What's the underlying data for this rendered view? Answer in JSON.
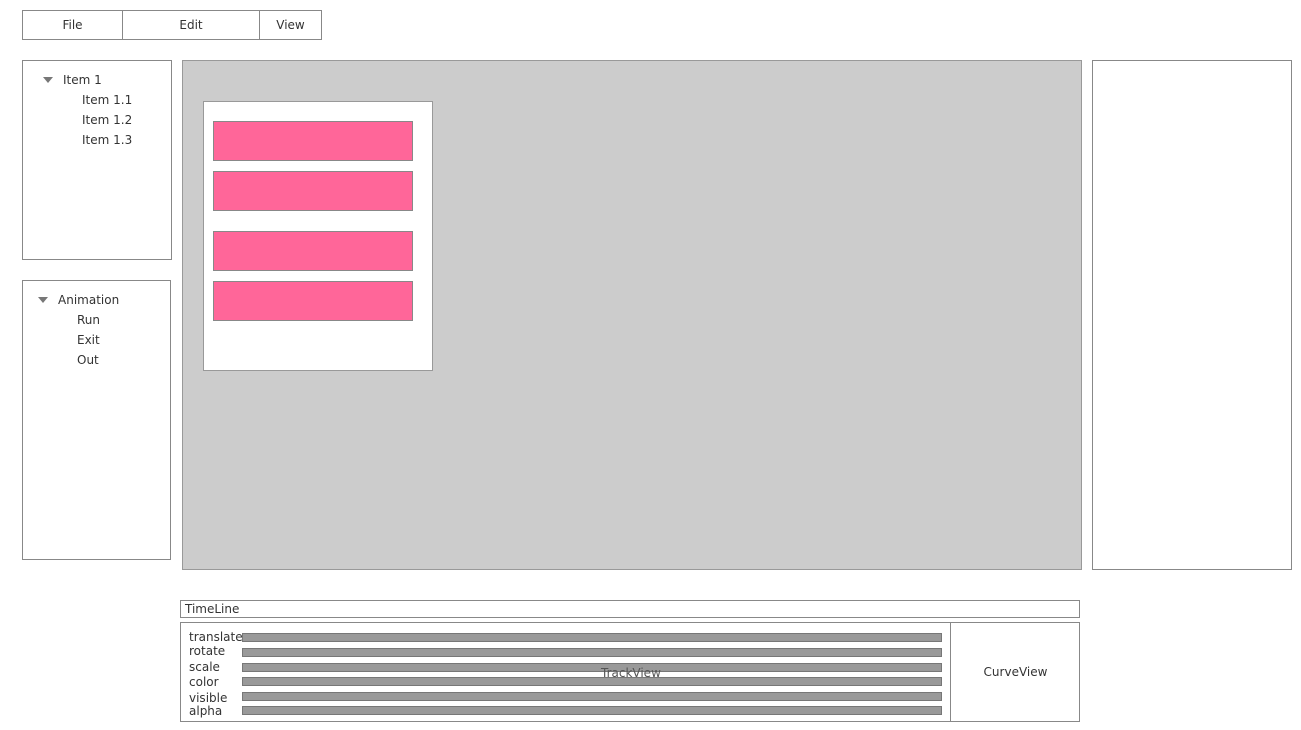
{
  "menu": {
    "file": "File",
    "edit": "Edit",
    "view": "View"
  },
  "tree_top": {
    "root": "Item 1",
    "children": [
      "Item 1.1",
      "Item 1.2",
      "Item 1.3"
    ]
  },
  "tree_bottom": {
    "root": "Animation",
    "children": [
      "Run",
      "Exit",
      "Out"
    ]
  },
  "timeline": {
    "title": "TimeLine",
    "tracks": [
      "translate",
      "rotate",
      "scale",
      "color",
      "visible",
      "alpha"
    ],
    "trackview_label": "TrackView",
    "curveview_label": "CurveView"
  },
  "colors": {
    "block_fill": "#ff6699",
    "canvas_bg": "#cccccc",
    "track_bar": "#999999"
  }
}
